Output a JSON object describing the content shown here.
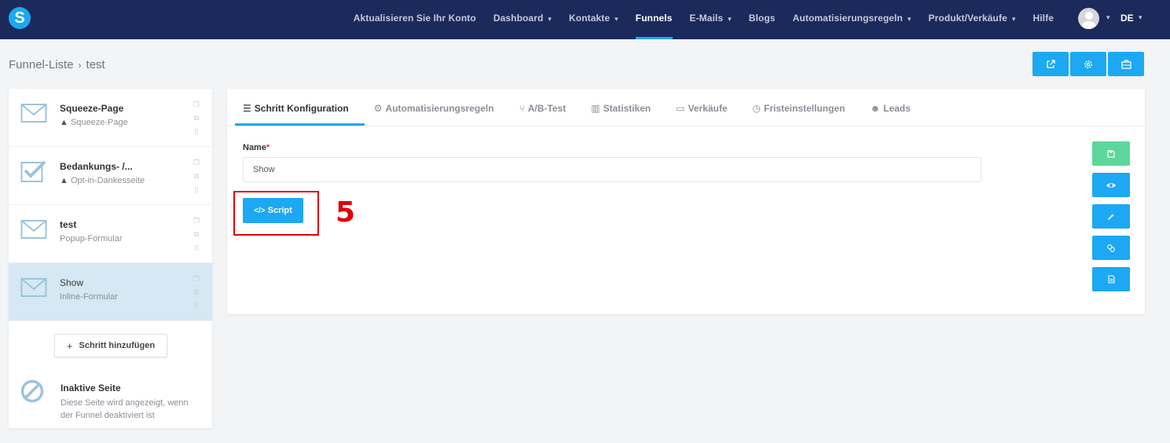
{
  "logo": {
    "letter": "S"
  },
  "nav": {
    "items": [
      {
        "label": "Aktualisieren Sie Ihr Konto",
        "caret": false,
        "active": false
      },
      {
        "label": "Dashboard",
        "caret": true,
        "active": false
      },
      {
        "label": "Kontakte",
        "caret": true,
        "active": false
      },
      {
        "label": "Funnels",
        "caret": false,
        "active": true
      },
      {
        "label": "E-Mails",
        "caret": true,
        "active": false
      },
      {
        "label": "Blogs",
        "caret": false,
        "active": false
      },
      {
        "label": "Automatisierungsregeln",
        "caret": true,
        "active": false
      },
      {
        "label": "Produkt/Verkäufe",
        "caret": true,
        "active": false
      },
      {
        "label": "Hilfe",
        "caret": false,
        "active": false
      }
    ],
    "language": "DE"
  },
  "breadcrumb": {
    "parent": "Funnel-Liste",
    "current": "test"
  },
  "top_actions": [
    {
      "icon": "external-link-icon"
    },
    {
      "icon": "settings-icon"
    },
    {
      "icon": "briefcase-icon"
    }
  ],
  "sidebar": {
    "steps": [
      {
        "title": "Squeeze-Page",
        "subtitle": "Squeeze-Page",
        "warning": true,
        "icon": "envelope-icon",
        "active": false
      },
      {
        "title": "Bedankungs- /...",
        "subtitle": "Opt-in-Dankesseite",
        "warning": true,
        "icon": "checkbox-icon",
        "active": false
      },
      {
        "title": "test",
        "subtitle": "Popup-Formular",
        "warning": false,
        "icon": "envelope-icon",
        "active": false
      },
      {
        "title": "Show",
        "subtitle": "Inline-Formular",
        "warning": false,
        "icon": "envelope-icon",
        "active": true
      }
    ],
    "add_step_label": "Schritt hinzufügen",
    "inactive": {
      "title": "Inaktive Seite",
      "description": "Diese Seite wird angezeigt, wenn der Funnel deaktiviert ist"
    }
  },
  "tabs": [
    {
      "label": "Schritt Konfiguration",
      "icon": "☰",
      "active": true
    },
    {
      "label": "Automatisierungsregeln",
      "icon": "⚙",
      "active": false
    },
    {
      "label": "A/B-Test",
      "icon": "⑂",
      "active": false
    },
    {
      "label": "Statistiken",
      "icon": "▥",
      "active": false
    },
    {
      "label": "Verkäufe",
      "icon": "▭",
      "active": false
    },
    {
      "label": "Fristeinstellungen",
      "icon": "◷",
      "active": false
    },
    {
      "label": "Leads",
      "icon": "☻",
      "active": false
    }
  ],
  "form": {
    "name_label": "Name",
    "required_mark": "*",
    "name_value": "Show",
    "script_label": "Script",
    "script_icon": "</>"
  },
  "annotation": {
    "number": "5"
  },
  "side_actions": [
    {
      "icon": "save-icon",
      "color": "#5cd69b"
    },
    {
      "icon": "eye-icon",
      "color": "#1ca8f2"
    },
    {
      "icon": "magic-wand-icon",
      "color": "#1ca8f2"
    },
    {
      "icon": "link-icon",
      "color": "#1ca8f2"
    },
    {
      "icon": "document-icon",
      "color": "#1ca8f2"
    }
  ]
}
